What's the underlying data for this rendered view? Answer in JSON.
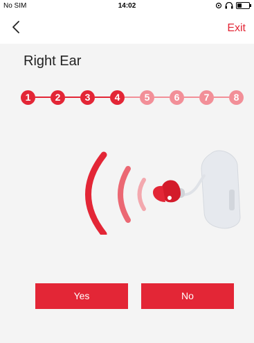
{
  "status_bar": {
    "carrier": "No SIM",
    "time": "14:02",
    "battery_level": 0.35
  },
  "nav": {
    "back_icon": "chevron-left-icon",
    "exit_label": "Exit"
  },
  "page": {
    "title": "Right Ear"
  },
  "stepper": {
    "steps": [
      "1",
      "2",
      "3",
      "4",
      "5",
      "6",
      "7",
      "8"
    ],
    "completed": 4
  },
  "illustration": {
    "icon": "hearing-aid-sound-icon"
  },
  "actions": {
    "yes_label": "Yes",
    "no_label": "No"
  },
  "colors": {
    "accent": "#e32636",
    "accent_light": "#f28f98",
    "background": "#f4f4f4"
  }
}
